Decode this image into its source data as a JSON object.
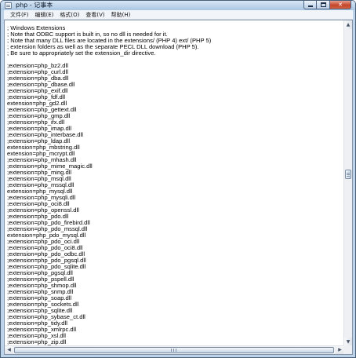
{
  "window": {
    "title": "php - 记事本",
    "icon": "notepad-icon"
  },
  "menu": [
    "文件(F)",
    "编辑(E)",
    "格式(O)",
    "查看(V)",
    "帮助(H)"
  ],
  "editor": {
    "lines": [
      "; Windows Extensions",
      "; Note that ODBC support is built in, so no dll is needed for it.",
      "; Note that many DLL files are located in the extensions/ (PHP 4) ext/ (PHP 5)",
      "; extension folders as well as the separate PECL DLL download (PHP 5).",
      "; Be sure to appropriately set the extension_dir directive.",
      "",
      ";extension=php_bz2.dll",
      ";extension=php_curl.dll",
      ";extension=php_dba.dll",
      ";extension=php_dbase.dll",
      ";extension=php_exif.dll",
      ";extension=php_fdf.dll",
      "extension=php_gd2.dll",
      ";extension=php_gettext.dll",
      ";extension=php_gmp.dll",
      ";extension=php_ifx.dll",
      ";extension=php_imap.dll",
      ";extension=php_interbase.dll",
      ";extension=php_ldap.dll",
      "extension=php_mbstring.dll",
      "extension=php_mcrypt.dll",
      ";extension=php_mhash.dll",
      ";extension=php_mime_magic.dll",
      ";extension=php_ming.dll",
      ";extension=php_msql.dll",
      ";extension=php_mssql.dll",
      "extension=php_mysql.dll",
      ";extension=php_mysqli.dll",
      ";extension=php_oci8.dll",
      ";extension=php_openssl.dll",
      ";extension=php_pdo.dll",
      ";extension=php_pdo_firebird.dll",
      ";extension=php_pdo_mssql.dll",
      "extension=php_pdo_mysql.dll",
      ";extension=php_pdo_oci.dll",
      ";extension=php_pdo_oci8.dll",
      ";extension=php_pdo_odbc.dll",
      ";extension=php_pdo_pgsql.dll",
      ";extension=php_pdo_sqlite.dll",
      ";extension=php_pgsql.dll",
      ";extension=php_pspell.dll",
      ";extension=php_shmop.dll",
      ";extension=php_snmp.dll",
      ";extension=php_soap.dll",
      ";extension=php_sockets.dll",
      ";extension=php_sqlite.dll",
      ";extension=php_sybase_ct.dll",
      ";extension=php_tidy.dll",
      ";extension=php_xmlrpc.dll",
      ";extension=php_xsl.dll",
      ";extension=php_zip.dll"
    ]
  },
  "scrollbars": {
    "vertical_position_fraction": 0.47
  },
  "icons": {
    "minimize": "minimize-icon",
    "maximize": "maximize-icon",
    "close": "close-icon",
    "scroll_up": "arrow-up-icon",
    "scroll_down": "arrow-down-icon",
    "scroll_left": "arrow-left-icon",
    "scroll_right": "arrow-right-icon"
  }
}
